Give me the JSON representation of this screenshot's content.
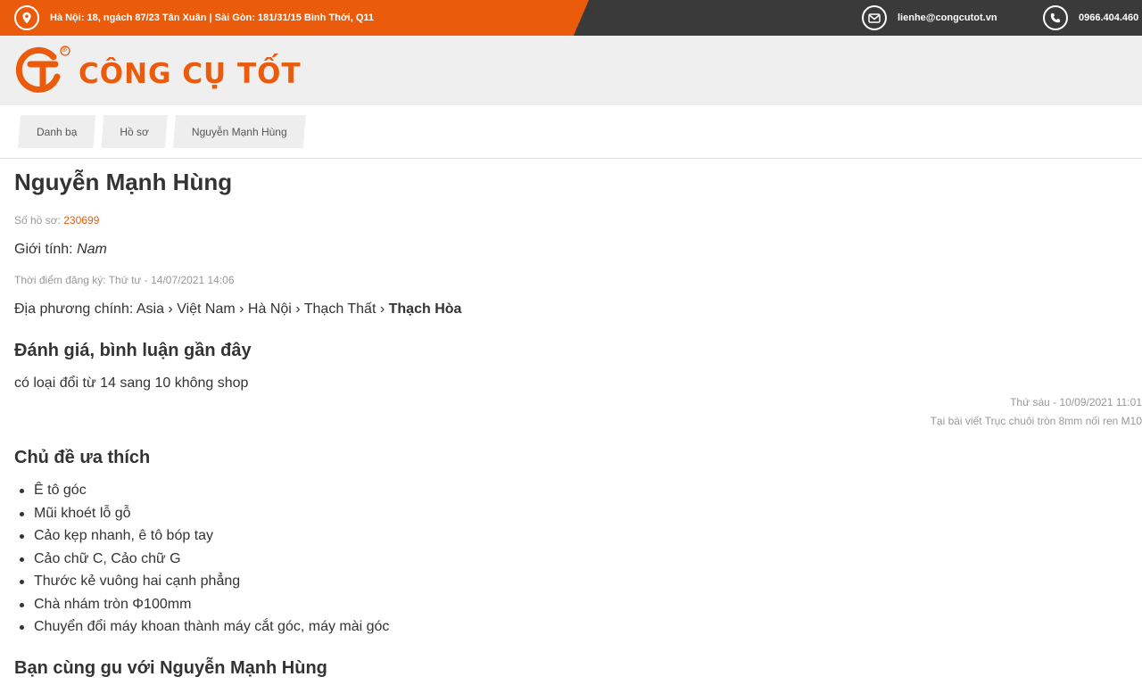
{
  "topbar": {
    "address": "Hà Nội: 18, ngách 87/23 Tân Xuân | Sài Gòn: 181/31/15 Bình Thới, Q11",
    "address_icon": "location-pin-icon",
    "email": "lienhe@congcutot.vn",
    "email_icon": "envelope-icon",
    "phone": "0966.404.460",
    "phone_icon": "phone-icon",
    "colors": {
      "accent": "#eb5b0c",
      "dark": "#3a3a3a"
    }
  },
  "header": {
    "logo_text": "CÔNG CỤ TỐT",
    "logo_registered": "®",
    "logo_icon": "gt-logo-icon"
  },
  "breadcrumb": [
    "Danh bạ",
    "Hồ sơ",
    "Nguyễn Mạnh Hùng"
  ],
  "profile": {
    "name": "Nguyễn Mạnh Hùng",
    "id_label": "Số hồ sơ:",
    "id_value": "230699",
    "gender_label": "Giới tính:",
    "gender_value": "Nam",
    "registered": "Thời điểm đăng ký: Thứ tư - 14/07/2021 14:06",
    "location_label": "Địa phương chính:",
    "location_path": "Asia › Việt Nam › Hà Nội › Thạch Thất ›",
    "location_last": "Thạch Hòa"
  },
  "reviews": {
    "heading": "Đánh giá, bình luận gần đây",
    "items": [
      {
        "text": "có loại đổi từ 14 sang 10 không shop",
        "time": "Thứ sáu - 10/09/2021 11:01",
        "where": "Tại bài viết Trục chuôi tròn 8mm nối ren M10"
      }
    ]
  },
  "topics": {
    "heading": "Chủ đề ưa thích",
    "items": [
      "Ê tô góc",
      "Mũi khoét lỗ gỗ",
      "Cảo kẹp nhanh, ê tô bóp tay",
      "Cảo chữ C, Cảo chữ G",
      "Thước kẻ vuông hai cạnh phẳng",
      "Chà nhám tròn Φ100mm",
      "Chuyển đổi máy khoan thành máy cắt góc, máy mài góc"
    ]
  },
  "similar": {
    "heading": "Bạn cùng gu với Nguyễn Mạnh Hùng"
  }
}
